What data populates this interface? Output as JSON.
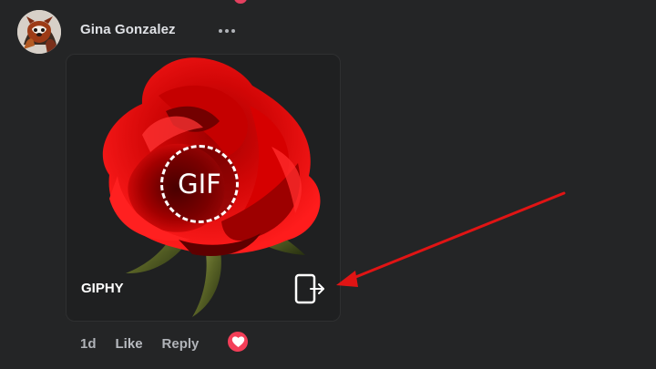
{
  "post": {
    "author_name": "Gina Gonzalez",
    "timestamp": "1d"
  },
  "gif_card": {
    "badge_text": "GIF",
    "provider_label": "GIPHY",
    "share_icon": "exit-share-icon"
  },
  "actions": {
    "like_label": "Like",
    "reply_label": "Reply",
    "reaction": "heart-icon"
  },
  "colors": {
    "background": "#242526",
    "text_primary": "#dfe1e5",
    "text_secondary": "#b0b3b8",
    "heart": "#f33e58",
    "annotation_arrow": "#e01414"
  },
  "icons": {
    "avatar": "red-panda-avatar",
    "more": "more-options-icon",
    "annotation": "arrow-annotation"
  }
}
